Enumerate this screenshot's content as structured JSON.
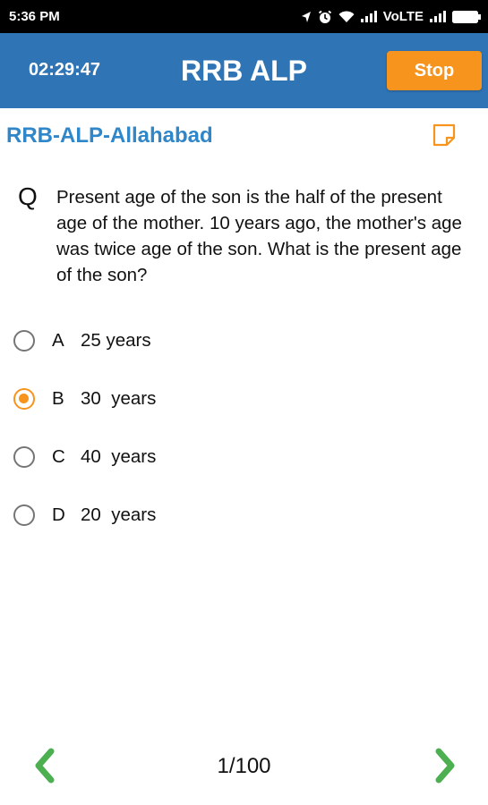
{
  "status_bar": {
    "time": "5:36 PM",
    "network_label": "VoLTE",
    "icons": [
      "location-arrow-icon",
      "alarm-icon",
      "wifi-icon",
      "signal-icon",
      "signal-icon",
      "battery-icon"
    ]
  },
  "header": {
    "timer": "02:29:47",
    "title": "RRB ALP",
    "stop_label": "Stop",
    "color": "#2f74b5",
    "stop_color": "#f7941d"
  },
  "exam": {
    "title": "RRB-ALP-Allahabad",
    "note_icon": "note-icon"
  },
  "question": {
    "letter": "Q",
    "text": "Present age of the son is the half of the present age of the mother. 10 years ago, the mother's age was twice age of the son. What is the present age of the son?"
  },
  "options": [
    {
      "letter": "A",
      "text": "25 years",
      "selected": false
    },
    {
      "letter": "B",
      "text": "30  years",
      "selected": true
    },
    {
      "letter": "C",
      "text": "40  years",
      "selected": false
    },
    {
      "letter": "D",
      "text": "20  years",
      "selected": false
    }
  ],
  "navigation": {
    "page": "1/100",
    "prev_icon": "chevron-left-icon",
    "next_icon": "chevron-right-icon",
    "arrow_color": "#4caf50"
  }
}
